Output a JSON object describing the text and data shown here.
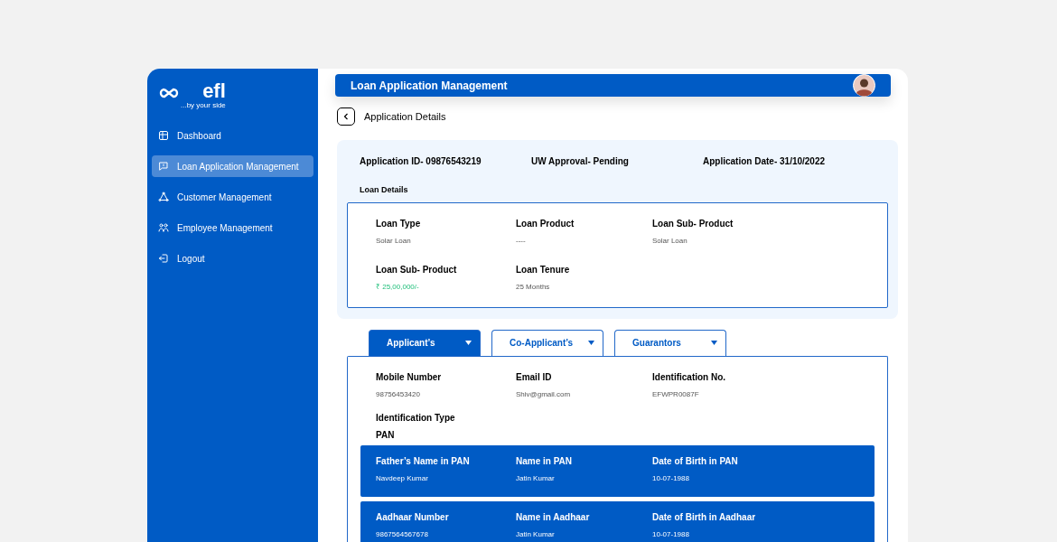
{
  "sidebar": {
    "logo": "efl",
    "tagline": "...by your side",
    "items": [
      {
        "label": "Dashboard",
        "selected": false
      },
      {
        "label": "Loan Application Management",
        "selected": true
      },
      {
        "label": "Customer Management",
        "selected": false
      },
      {
        "label": "Employee Management",
        "selected": false
      },
      {
        "label": "Logout",
        "selected": false
      }
    ]
  },
  "header": {
    "title": "Loan Application Management"
  },
  "page_title": "Application Details",
  "summary": [
    "Application ID- 09876543219",
    "UW Approval- Pending",
    "Application Date- 31/10/2022"
  ],
  "loan_details": {
    "title": "Loan Details",
    "fields": [
      {
        "label": "Loan Type",
        "value": "Solar Loan",
        "kind": "plain"
      },
      {
        "label": "Loan Product",
        "value": "----",
        "kind": "plain"
      },
      {
        "label": "Loan Sub- Product",
        "value": "Solar Loan",
        "kind": "plain"
      },
      {
        "label": "Loan Sub- Product",
        "value": "₹ 25,00,000/-",
        "kind": "amount"
      },
      {
        "label": "Loan Tenure",
        "value": "25 Months",
        "kind": "plain"
      }
    ]
  },
  "tabs": [
    {
      "label": "Applicant’s",
      "selected": true
    },
    {
      "label": "Co-Applicant’s",
      "selected": false
    },
    {
      "label": "Guarantors",
      "selected": false
    }
  ],
  "applicant": {
    "fields": [
      {
        "label": "Mobile Number",
        "value": "98756453420"
      },
      {
        "label": "Email ID",
        "value": "Shiv@gmail.com"
      },
      {
        "label": "Identification No.",
        "value": "EFWPR0087F"
      }
    ],
    "identification_type": {
      "label": "Identification Type",
      "value": "PAN"
    },
    "cards": [
      [
        {
          "label": "Father’s Name in PAN",
          "value": "Navdeep Kumar"
        },
        {
          "label": "Name in PAN",
          "value": "Jatin Kumar"
        },
        {
          "label": "Date of Birth in PAN",
          "value": "10-07-1988"
        }
      ],
      [
        {
          "label": "Aadhaar Number",
          "value": "9867564567678"
        },
        {
          "label": "Name in Aadhaar",
          "value": "Jatin Kumar"
        },
        {
          "label": "Date of Birth in Aadhaar",
          "value": "10-07-1988"
        }
      ]
    ]
  }
}
